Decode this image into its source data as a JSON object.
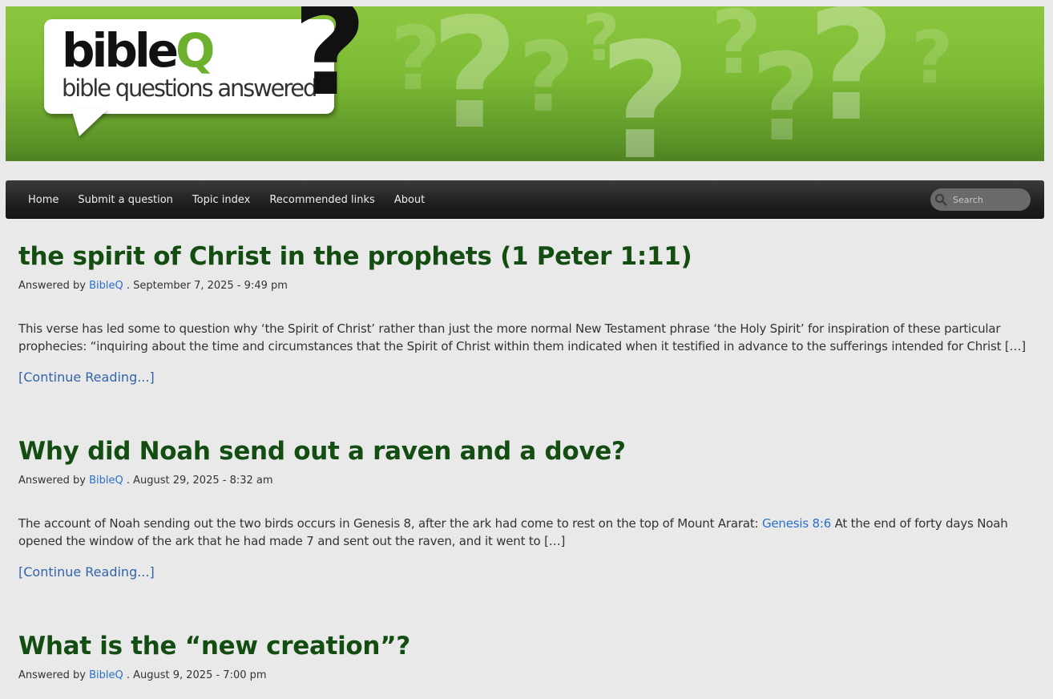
{
  "header": {
    "logo_name": "bible",
    "logo_name_q": "Q",
    "logo_tagline": "bible questions answered"
  },
  "nav": {
    "items": [
      {
        "label": "Home"
      },
      {
        "label": "Submit a question"
      },
      {
        "label": "Topic index"
      },
      {
        "label": "Recommended links"
      },
      {
        "label": "About"
      }
    ],
    "search_placeholder": "Search"
  },
  "posts": [
    {
      "title": "the spirit of Christ in the prophets (1 Peter 1:11)",
      "meta_prefix": "Answered by",
      "author": "BibleQ",
      "meta_date": ". September 7, 2025 - 9:49 pm",
      "excerpt": "This verse has led some to question why ‘the Spirit of Christ’ rather than just the more normal New Testament phrase ‘the Holy Spirit’ for inspiration of these particular prophecies: “inquiring about the time and circumstances that the Spirit of Christ within them indicated when it testified in advance to the sufferings intended for Christ […]",
      "continue": "[Continue Reading...]"
    },
    {
      "title": "Why did Noah send out a raven and a dove?",
      "meta_prefix": "Answered by",
      "author": "BibleQ",
      "meta_date": ". August 29, 2025 - 8:32 am",
      "excerpt_before": "The account of Noah sending out the two birds occurs in Genesis 8, after the ark had come to rest on the top of Mount Ararat: ",
      "excerpt_link": "Genesis 8:6",
      "excerpt_after": " At the end of forty days Noah opened the window of the ark that he had made 7 and sent out the raven, and it went to […]",
      "continue": "[Continue Reading...]"
    },
    {
      "title": "What is the “new creation”?",
      "meta_prefix": "Answered by",
      "author": "BibleQ",
      "meta_date": ". August 9, 2025 - 7:00 pm"
    }
  ]
}
